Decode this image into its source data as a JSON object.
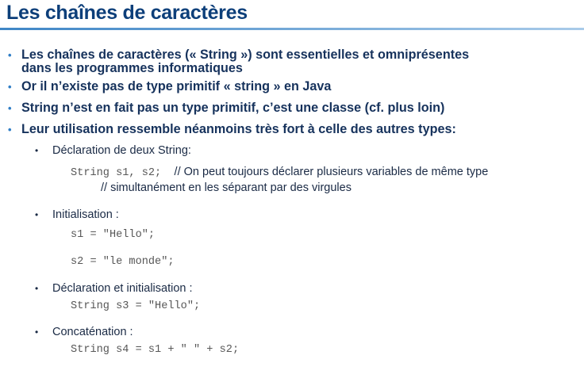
{
  "title": "Les chaînes de caractères",
  "bullets": [
    {
      "line1": "Les chaînes de caractères (« String ») sont essentielles et omniprésentes",
      "line2": "dans les programmes informatiques"
    },
    {
      "text": "Or il n’existe pas de type primitif « string » en Java"
    },
    {
      "text": "String n’est en fait pas un type primitif, c’est une classe (cf. plus loin)"
    },
    {
      "text": "Leur utilisation ressemble néanmoins très fort à celle des autres types:"
    }
  ],
  "sub_bullets": [
    {
      "label": "Déclaration de deux String:",
      "code": "String s1, s2;",
      "comment_line1": "// On peut toujours déclarer plusieurs variables de même type",
      "comment_line2": "// simultanément en les séparant par des virgules"
    },
    {
      "label": "Initialisation :",
      "code_line1": "s1 = \"Hello\";",
      "code_line2": "s2 = \"le monde\";"
    },
    {
      "label": "Déclaration et initialisation :",
      "code": "String s3 = \"Hello\";"
    },
    {
      "label": "Concaténation :",
      "code": "String s4 = s1 + \" \" + s2;"
    }
  ],
  "colors": {
    "title": "#0d3f7a",
    "bullet_marker": "#2f7ec6",
    "bullet_text": "#16325c",
    "code": "#575757",
    "rule_start": "#3f86c6",
    "rule_end": "#a9cbe9"
  }
}
